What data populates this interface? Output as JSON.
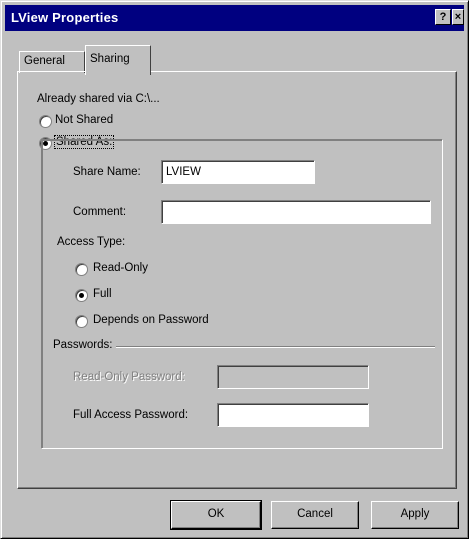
{
  "window": {
    "title": "LView Properties",
    "help_glyph": "?",
    "close_glyph": "×"
  },
  "tabs": [
    {
      "label": "General",
      "active": false
    },
    {
      "label": "Sharing",
      "active": true
    }
  ],
  "sharing": {
    "already_shared": "Already shared via C:\\...",
    "not_shared": "Not Shared",
    "shared_as": "Shared As:",
    "selected": "shared_as",
    "share_name_label": "Share Name:",
    "share_name_value": "LVIEW",
    "comment_label": "Comment:",
    "comment_value": "",
    "access_type_label": "Access Type:",
    "access": {
      "read_only": "Read-Only",
      "full": "Full",
      "depends": "Depends on Password",
      "selected": "full"
    },
    "passwords_label": "Passwords:",
    "read_only_password_label": "Read-Only Password:",
    "read_only_password_value": "",
    "full_access_password_label": "Full Access Password:",
    "full_access_password_value": ""
  },
  "buttons": {
    "ok": "OK",
    "cancel": "Cancel",
    "apply": "Apply"
  }
}
